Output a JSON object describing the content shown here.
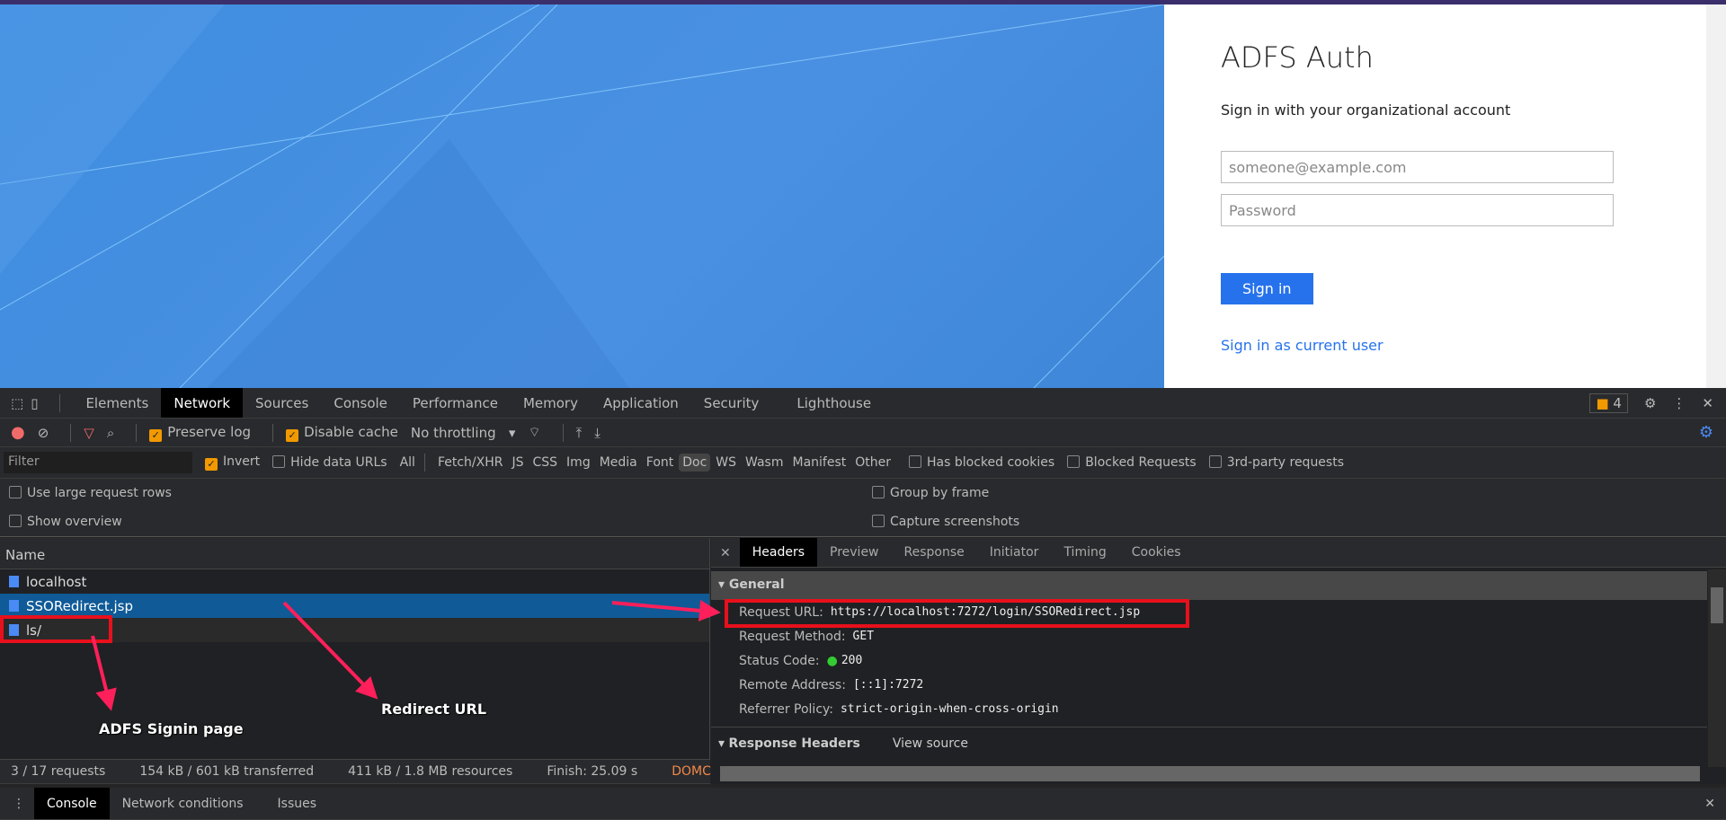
{
  "login": {
    "title": "ADFS Auth",
    "subtitle": "Sign in with your organizational account",
    "email_placeholder": "someone@example.com",
    "password_placeholder": "Password",
    "signin": "Sign in",
    "current_user": "Sign in as current user"
  },
  "devtools": {
    "tabs": [
      "Elements",
      "Network",
      "Sources",
      "Console",
      "Performance",
      "Memory",
      "Application",
      "Security",
      "Lighthouse"
    ],
    "issues_count": "4",
    "toolbar": {
      "preserve_log": "Preserve log",
      "disable_cache": "Disable cache",
      "throttling": "No throttling"
    },
    "filter": {
      "placeholder": "Filter",
      "invert": "Invert",
      "hide_data_urls": "Hide data URLs",
      "types": [
        "All",
        "Fetch/XHR",
        "JS",
        "CSS",
        "Img",
        "Media",
        "Font",
        "Doc",
        "WS",
        "Wasm",
        "Manifest",
        "Other"
      ],
      "active_type": "Doc",
      "has_blocked_cookies": "Has blocked cookies",
      "blocked_requests": "Blocked Requests",
      "third_party": "3rd-party requests"
    },
    "options": {
      "large_rows": "Use large request rows",
      "show_overview": "Show overview",
      "group_by_frame": "Group by frame",
      "capture_screenshots": "Capture screenshots"
    },
    "requests": {
      "header": "Name",
      "rows": [
        "localhost",
        "SSORedirect.jsp",
        "ls/"
      ],
      "selected": 1
    },
    "details": {
      "tabs": [
        "Headers",
        "Preview",
        "Response",
        "Initiator",
        "Timing",
        "Cookies"
      ],
      "general": "General",
      "fields": [
        {
          "k": "Request URL:",
          "v": "https://localhost:7272/login/SSORedirect.jsp"
        },
        {
          "k": "Request Method:",
          "v": "GET"
        },
        {
          "k": "Status Code:",
          "v": "200"
        },
        {
          "k": "Remote Address:",
          "v": "[::1]:7272"
        },
        {
          "k": "Referrer Policy:",
          "v": "strict-origin-when-cross-origin"
        }
      ],
      "response_headers": "Response Headers",
      "view_source": "View source"
    },
    "status": {
      "requests": "3 / 17 requests",
      "transferred": "154 kB / 601 kB transferred",
      "resources": "411 kB / 1.8 MB resources",
      "finish": "Finish: 25.09 s",
      "dcl": "DOMContentLoaded"
    },
    "drawer": {
      "tabs": [
        "Console",
        "Network conditions",
        "Issues"
      ]
    }
  },
  "annotations": {
    "signin": "ADFS Signin page",
    "redirect": "Redirect URL"
  },
  "colors": {
    "accent": "#2672ec",
    "annotation": "#ff1f5a",
    "box": "#e8101c"
  }
}
